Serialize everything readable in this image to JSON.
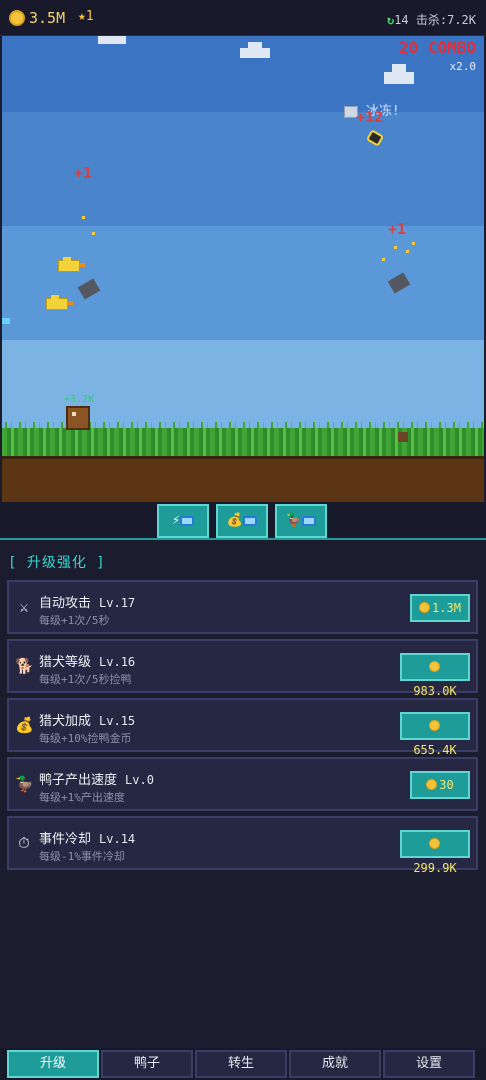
{
  "topbar": {
    "money": "3.5M",
    "stars": "★1",
    "refresh_icon": "↻",
    "refresh_count": "14",
    "kills": "击杀:7.2K"
  },
  "game": {
    "combo": "20 COMBO",
    "multiplier": "x2.0",
    "freeze_text": "冰冻!",
    "floats": {
      "plus12": "+12",
      "plus1_left": "+1",
      "plus1_right": "+1",
      "green_gain": "+3.2K"
    }
  },
  "quick_buttons": [
    {
      "icon": "lightning-tv-icon",
      "glyph": "⚡"
    },
    {
      "icon": "moneybag-tv-icon",
      "glyph": "💰"
    },
    {
      "icon": "duck-tv-icon",
      "glyph": "🦆"
    }
  ],
  "upgrades": {
    "title": "[ 升级强化 ]",
    "items": [
      {
        "icon": "swords-icon",
        "glyph": "⚔",
        "name": "自动攻击",
        "level": "Lv.17",
        "desc": "每级+1次/5秒",
        "cost": "1.3M"
      },
      {
        "icon": "dog-icon",
        "glyph": "🐕",
        "name": "猎犬等级",
        "level": "Lv.16",
        "desc": "每级+1次/5秒捡鸭",
        "cost": "983.0K"
      },
      {
        "icon": "moneybag-icon",
        "glyph": "💰",
        "name": "猎犬加成",
        "level": "Lv.15",
        "desc": "每级+10%捡鸭金币",
        "cost": "655.4K"
      },
      {
        "icon": "duck-icon",
        "glyph": "🦆",
        "name": "鸭子产出速度",
        "level": "Lv.0",
        "desc": "每级+1%产出速度",
        "cost": "30"
      },
      {
        "icon": "stopwatch-icon",
        "glyph": "⏱",
        "name": "事件冷却",
        "level": "Lv.14",
        "desc": "每级-1%事件冷却",
        "cost": "299.9K"
      }
    ]
  },
  "tabs": [
    "升级",
    "鸭子",
    "转生",
    "成就",
    "设置"
  ],
  "colors": {
    "accent": "#1e9c99",
    "panel": "#262843",
    "combo": "#e0303a",
    "coin": "#f3c33a"
  }
}
